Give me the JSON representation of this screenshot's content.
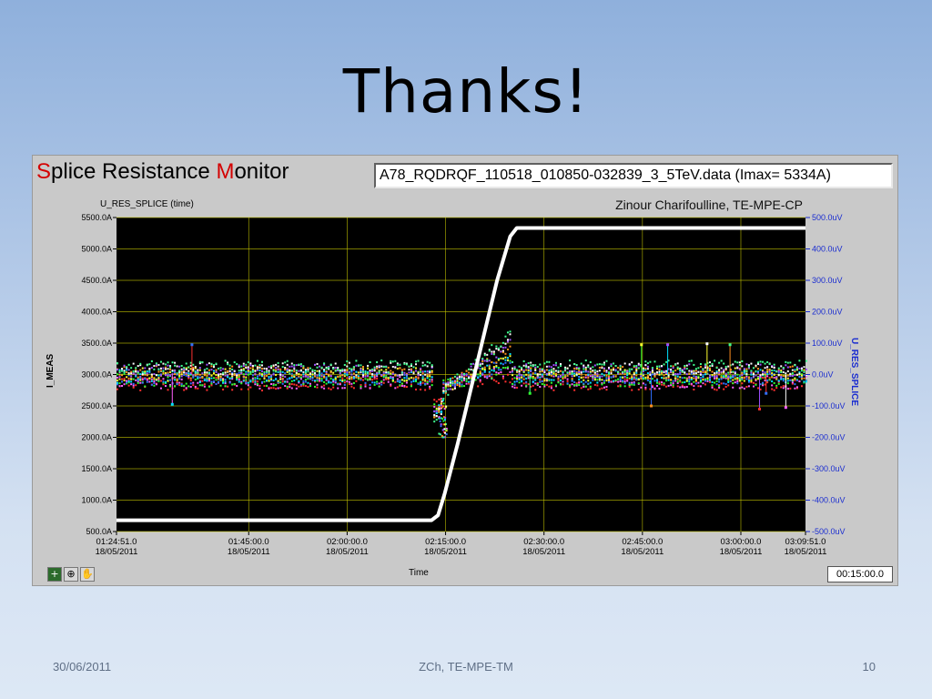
{
  "slide": {
    "title": "Thanks!",
    "footer_date": "30/06/2011",
    "footer_center": "ZCh, TE-MPE-TM",
    "page_number": "10"
  },
  "monitor": {
    "title_parts": [
      "S",
      "plice ",
      "Resistance ",
      "M",
      "onitor"
    ],
    "file_label": "A78_RQDRQF_110518_010850-032839_3_5TeV.data (Imax= 5334A)",
    "plot_name": "U_RES_SPLICE (time)",
    "author": "Zinour Charifoulline, TE-MPE-CP",
    "x_axis_label": "Time",
    "left_axis_label": "I_MEAS",
    "right_axis_label": "U_RES_SPLICE",
    "time_interval": "00:15:00.0",
    "tools": [
      "+",
      "⊕",
      "✋"
    ]
  },
  "colors": {
    "accent_red": "#d40000",
    "right_axis_blue": "#1a2dd0",
    "plot_bg": "#000000",
    "grid": "#c8c800"
  },
  "chart_data": {
    "type": "line",
    "x_ticks": [
      {
        "time": "01:24:51.0",
        "date": "18/05/2011",
        "min": 0
      },
      {
        "time": "01:45:00.0",
        "date": "18/05/2011",
        "min": 20.15
      },
      {
        "time": "02:00:00.0",
        "date": "18/05/2011",
        "min": 35.15
      },
      {
        "time": "02:15:00.0",
        "date": "18/05/2011",
        "min": 50.15
      },
      {
        "time": "02:30:00.0",
        "date": "18/05/2011",
        "min": 65.15
      },
      {
        "time": "02:45:00.0",
        "date": "18/05/2011",
        "min": 80.15
      },
      {
        "time": "03:00:00.0",
        "date": "18/05/2011",
        "min": 95.15
      },
      {
        "time": "03:09:51.0",
        "date": "18/05/2011",
        "min": 105
      }
    ],
    "x_range_min": [
      0,
      105
    ],
    "y_left_ticks": [
      "5500.0A",
      "5000.0A",
      "4500.0A",
      "4000.0A",
      "3500.0A",
      "3000.0A",
      "2500.0A",
      "2000.0A",
      "1500.0A",
      "1000.0A",
      "500.0A"
    ],
    "y_left_values": [
      5500,
      5000,
      4500,
      4000,
      3500,
      3000,
      2500,
      2000,
      1500,
      1000,
      500
    ],
    "y_left_range": [
      500,
      5500
    ],
    "y_right_ticks": [
      "500.0uV",
      "400.0uV",
      "300.0uV",
      "200.0uV",
      "100.0uV",
      "0.0uV",
      "-100.0uV",
      "-200.0uV",
      "-300.0uV",
      "-400.0uV",
      "-500.0uV"
    ],
    "y_right_range": [
      -500,
      500
    ],
    "grid": true,
    "current_series": {
      "color": "#ffffff",
      "points_min_A": [
        [
          0,
          680
        ],
        [
          48,
          680
        ],
        [
          49,
          760
        ],
        [
          50,
          1100
        ],
        [
          52,
          1900
        ],
        [
          55,
          3200
        ],
        [
          58,
          4500
        ],
        [
          60,
          5200
        ],
        [
          61,
          5334
        ],
        [
          105,
          5334
        ]
      ]
    },
    "noise_band": {
      "center_uV": 0,
      "half_width_uV": 35,
      "ramp_drop_uV": -180,
      "colors": [
        "#ff3030",
        "#ff60ff",
        "#30ff30",
        "#3070ff",
        "#00e0ff",
        "#ffff30",
        "#ff9020",
        "#a050ff",
        "#ffffff",
        "#40ff90"
      ]
    }
  }
}
